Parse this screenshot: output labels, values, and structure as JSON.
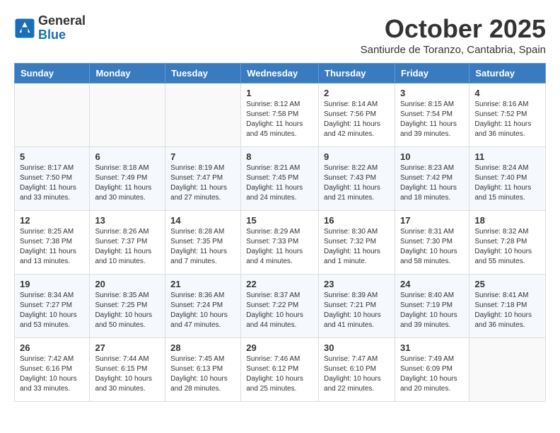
{
  "logo": {
    "general": "General",
    "blue": "Blue"
  },
  "title": "October 2025",
  "subtitle": "Santiurde de Toranzo, Cantabria, Spain",
  "weekdays": [
    "Sunday",
    "Monday",
    "Tuesday",
    "Wednesday",
    "Thursday",
    "Friday",
    "Saturday"
  ],
  "weeks": [
    [
      {
        "day": "",
        "text": ""
      },
      {
        "day": "",
        "text": ""
      },
      {
        "day": "",
        "text": ""
      },
      {
        "day": "1",
        "text": "Sunrise: 8:12 AM\nSunset: 7:58 PM\nDaylight: 11 hours and 45 minutes."
      },
      {
        "day": "2",
        "text": "Sunrise: 8:14 AM\nSunset: 7:56 PM\nDaylight: 11 hours and 42 minutes."
      },
      {
        "day": "3",
        "text": "Sunrise: 8:15 AM\nSunset: 7:54 PM\nDaylight: 11 hours and 39 minutes."
      },
      {
        "day": "4",
        "text": "Sunrise: 8:16 AM\nSunset: 7:52 PM\nDaylight: 11 hours and 36 minutes."
      }
    ],
    [
      {
        "day": "5",
        "text": "Sunrise: 8:17 AM\nSunset: 7:50 PM\nDaylight: 11 hours and 33 minutes."
      },
      {
        "day": "6",
        "text": "Sunrise: 8:18 AM\nSunset: 7:49 PM\nDaylight: 11 hours and 30 minutes."
      },
      {
        "day": "7",
        "text": "Sunrise: 8:19 AM\nSunset: 7:47 PM\nDaylight: 11 hours and 27 minutes."
      },
      {
        "day": "8",
        "text": "Sunrise: 8:21 AM\nSunset: 7:45 PM\nDaylight: 11 hours and 24 minutes."
      },
      {
        "day": "9",
        "text": "Sunrise: 8:22 AM\nSunset: 7:43 PM\nDaylight: 11 hours and 21 minutes."
      },
      {
        "day": "10",
        "text": "Sunrise: 8:23 AM\nSunset: 7:42 PM\nDaylight: 11 hours and 18 minutes."
      },
      {
        "day": "11",
        "text": "Sunrise: 8:24 AM\nSunset: 7:40 PM\nDaylight: 11 hours and 15 minutes."
      }
    ],
    [
      {
        "day": "12",
        "text": "Sunrise: 8:25 AM\nSunset: 7:38 PM\nDaylight: 11 hours and 13 minutes."
      },
      {
        "day": "13",
        "text": "Sunrise: 8:26 AM\nSunset: 7:37 PM\nDaylight: 11 hours and 10 minutes."
      },
      {
        "day": "14",
        "text": "Sunrise: 8:28 AM\nSunset: 7:35 PM\nDaylight: 11 hours and 7 minutes."
      },
      {
        "day": "15",
        "text": "Sunrise: 8:29 AM\nSunset: 7:33 PM\nDaylight: 11 hours and 4 minutes."
      },
      {
        "day": "16",
        "text": "Sunrise: 8:30 AM\nSunset: 7:32 PM\nDaylight: 11 hours and 1 minute."
      },
      {
        "day": "17",
        "text": "Sunrise: 8:31 AM\nSunset: 7:30 PM\nDaylight: 10 hours and 58 minutes."
      },
      {
        "day": "18",
        "text": "Sunrise: 8:32 AM\nSunset: 7:28 PM\nDaylight: 10 hours and 55 minutes."
      }
    ],
    [
      {
        "day": "19",
        "text": "Sunrise: 8:34 AM\nSunset: 7:27 PM\nDaylight: 10 hours and 53 minutes."
      },
      {
        "day": "20",
        "text": "Sunrise: 8:35 AM\nSunset: 7:25 PM\nDaylight: 10 hours and 50 minutes."
      },
      {
        "day": "21",
        "text": "Sunrise: 8:36 AM\nSunset: 7:24 PM\nDaylight: 10 hours and 47 minutes."
      },
      {
        "day": "22",
        "text": "Sunrise: 8:37 AM\nSunset: 7:22 PM\nDaylight: 10 hours and 44 minutes."
      },
      {
        "day": "23",
        "text": "Sunrise: 8:39 AM\nSunset: 7:21 PM\nDaylight: 10 hours and 41 minutes."
      },
      {
        "day": "24",
        "text": "Sunrise: 8:40 AM\nSunset: 7:19 PM\nDaylight: 10 hours and 39 minutes."
      },
      {
        "day": "25",
        "text": "Sunrise: 8:41 AM\nSunset: 7:18 PM\nDaylight: 10 hours and 36 minutes."
      }
    ],
    [
      {
        "day": "26",
        "text": "Sunrise: 7:42 AM\nSunset: 6:16 PM\nDaylight: 10 hours and 33 minutes."
      },
      {
        "day": "27",
        "text": "Sunrise: 7:44 AM\nSunset: 6:15 PM\nDaylight: 10 hours and 30 minutes."
      },
      {
        "day": "28",
        "text": "Sunrise: 7:45 AM\nSunset: 6:13 PM\nDaylight: 10 hours and 28 minutes."
      },
      {
        "day": "29",
        "text": "Sunrise: 7:46 AM\nSunset: 6:12 PM\nDaylight: 10 hours and 25 minutes."
      },
      {
        "day": "30",
        "text": "Sunrise: 7:47 AM\nSunset: 6:10 PM\nDaylight: 10 hours and 22 minutes."
      },
      {
        "day": "31",
        "text": "Sunrise: 7:49 AM\nSunset: 6:09 PM\nDaylight: 10 hours and 20 minutes."
      },
      {
        "day": "",
        "text": ""
      }
    ]
  ]
}
